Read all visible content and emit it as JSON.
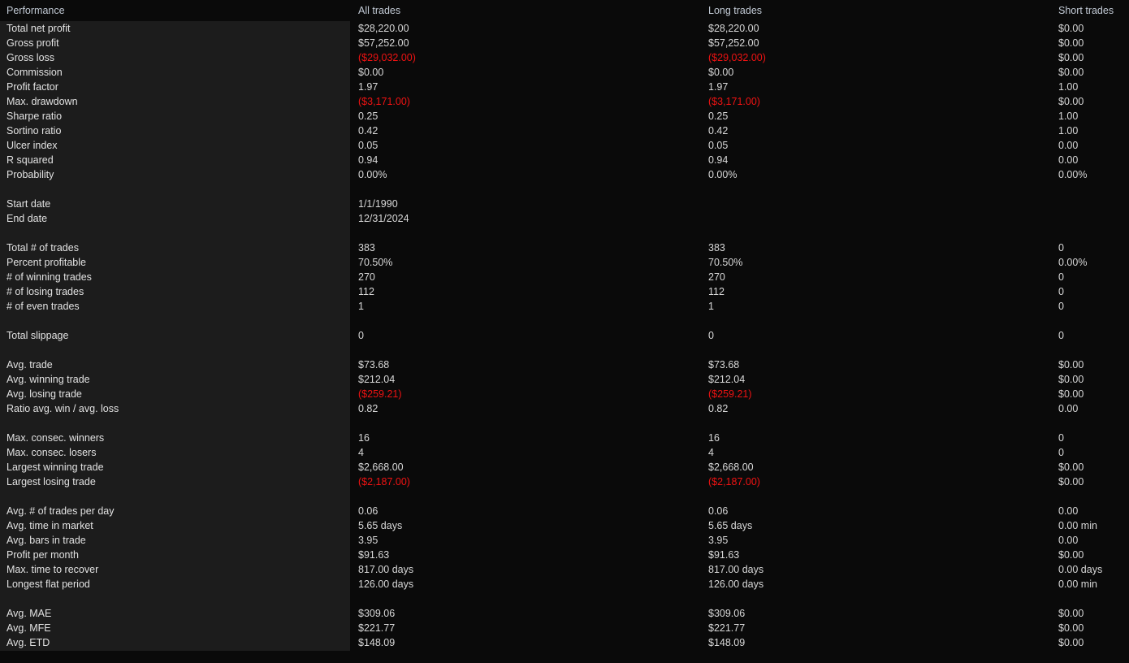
{
  "report": {
    "title": "Performance",
    "columns": [
      "Performance",
      "All trades",
      "Long trades",
      "Short trades"
    ],
    "colors": {
      "background": "#0a0a0a",
      "label_panel": "#1c1c1c",
      "header_text": "#c3cbd6",
      "value_text": "#d8d8d8",
      "negative_text": "#ef1212"
    },
    "sections": [
      {
        "rows": [
          {
            "label": "Total net profit",
            "all": "$28,220.00",
            "long": "$28,220.00",
            "short": "$0.00",
            "negative": false
          },
          {
            "label": "Gross profit",
            "all": "$57,252.00",
            "long": "$57,252.00",
            "short": "$0.00",
            "negative": false
          },
          {
            "label": "Gross loss",
            "all": "($29,032.00)",
            "long": "($29,032.00)",
            "short": "$0.00",
            "negative": true,
            "negative_cols": [
              "all",
              "long"
            ]
          },
          {
            "label": "Commission",
            "all": "$0.00",
            "long": "$0.00",
            "short": "$0.00",
            "negative": false
          },
          {
            "label": "Profit factor",
            "all": "1.97",
            "long": "1.97",
            "short": "1.00",
            "negative": false
          },
          {
            "label": "Max. drawdown",
            "all": "($3,171.00)",
            "long": "($3,171.00)",
            "short": "$0.00",
            "negative": true,
            "negative_cols": [
              "all",
              "long"
            ]
          },
          {
            "label": "Sharpe ratio",
            "all": "0.25",
            "long": "0.25",
            "short": "1.00",
            "negative": false
          },
          {
            "label": "Sortino ratio",
            "all": "0.42",
            "long": "0.42",
            "short": "1.00",
            "negative": false
          },
          {
            "label": "Ulcer index",
            "all": "0.05",
            "long": "0.05",
            "short": "0.00",
            "negative": false
          },
          {
            "label": "R squared",
            "all": "0.94",
            "long": "0.94",
            "short": "0.00",
            "negative": false
          },
          {
            "label": "Probability",
            "all": "0.00%",
            "long": "0.00%",
            "short": "0.00%",
            "negative": false
          }
        ]
      },
      {
        "rows": [
          {
            "label": "Start date",
            "all": "1/1/1990",
            "long": "",
            "short": "",
            "negative": false
          },
          {
            "label": "End date",
            "all": "12/31/2024",
            "long": "",
            "short": "",
            "negative": false
          }
        ]
      },
      {
        "rows": [
          {
            "label": "Total # of trades",
            "all": "383",
            "long": "383",
            "short": "0",
            "negative": false
          },
          {
            "label": "Percent profitable",
            "all": "70.50%",
            "long": "70.50%",
            "short": "0.00%",
            "negative": false
          },
          {
            "label": "# of winning trades",
            "all": "270",
            "long": "270",
            "short": "0",
            "negative": false
          },
          {
            "label": "# of losing trades",
            "all": "112",
            "long": "112",
            "short": "0",
            "negative": false
          },
          {
            "label": "# of even trades",
            "all": "1",
            "long": "1",
            "short": "0",
            "negative": false
          }
        ]
      },
      {
        "rows": [
          {
            "label": "Total slippage",
            "all": "0",
            "long": "0",
            "short": "0",
            "negative": false
          }
        ]
      },
      {
        "rows": [
          {
            "label": "Avg. trade",
            "all": "$73.68",
            "long": "$73.68",
            "short": "$0.00",
            "negative": false
          },
          {
            "label": "Avg. winning trade",
            "all": "$212.04",
            "long": "$212.04",
            "short": "$0.00",
            "negative": false
          },
          {
            "label": "Avg. losing trade",
            "all": "($259.21)",
            "long": "($259.21)",
            "short": "$0.00",
            "negative": true,
            "negative_cols": [
              "all",
              "long"
            ]
          },
          {
            "label": "Ratio avg. win / avg. loss",
            "all": "0.82",
            "long": "0.82",
            "short": "0.00",
            "negative": false
          }
        ]
      },
      {
        "rows": [
          {
            "label": "Max. consec. winners",
            "all": "16",
            "long": "16",
            "short": "0",
            "negative": false
          },
          {
            "label": "Max. consec. losers",
            "all": "4",
            "long": "4",
            "short": "0",
            "negative": false
          },
          {
            "label": "Largest winning trade",
            "all": "$2,668.00",
            "long": "$2,668.00",
            "short": "$0.00",
            "negative": false
          },
          {
            "label": "Largest losing trade",
            "all": "($2,187.00)",
            "long": "($2,187.00)",
            "short": "$0.00",
            "negative": true,
            "negative_cols": [
              "all",
              "long"
            ]
          }
        ]
      },
      {
        "rows": [
          {
            "label": "Avg. # of trades per day",
            "all": "0.06",
            "long": "0.06",
            "short": "0.00",
            "negative": false
          },
          {
            "label": "Avg. time in market",
            "all": "5.65 days",
            "long": "5.65 days",
            "short": "0.00 min",
            "negative": false
          },
          {
            "label": "Avg. bars in trade",
            "all": "3.95",
            "long": "3.95",
            "short": "0.00",
            "negative": false
          },
          {
            "label": "Profit per month",
            "all": "$91.63",
            "long": "$91.63",
            "short": "$0.00",
            "negative": false
          },
          {
            "label": "Max. time to recover",
            "all": "817.00 days",
            "long": "817.00 days",
            "short": "0.00 days",
            "negative": false
          },
          {
            "label": "Longest flat period",
            "all": "126.00 days",
            "long": "126.00 days",
            "short": "0.00 min",
            "negative": false
          }
        ]
      },
      {
        "rows": [
          {
            "label": "Avg. MAE",
            "all": "$309.06",
            "long": "$309.06",
            "short": "$0.00",
            "negative": false
          },
          {
            "label": "Avg. MFE",
            "all": "$221.77",
            "long": "$221.77",
            "short": "$0.00",
            "negative": false
          },
          {
            "label": "Avg. ETD",
            "all": "$148.09",
            "long": "$148.09",
            "short": "$0.00",
            "negative": false
          }
        ]
      }
    ]
  }
}
